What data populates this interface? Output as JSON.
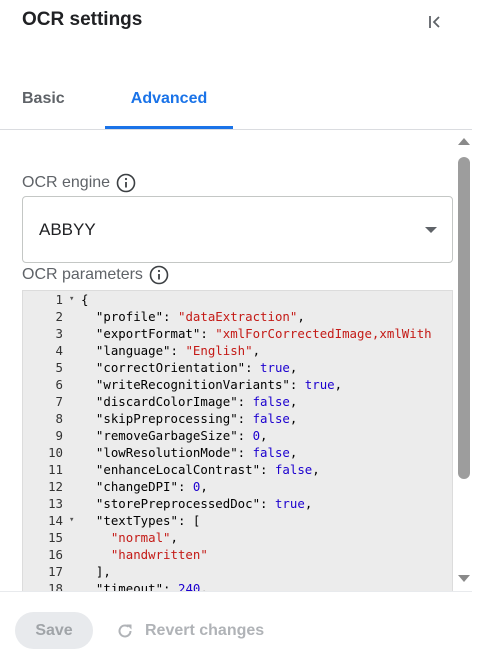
{
  "header": {
    "title": "OCR settings",
    "collapse_icon": "collapse-panel-icon"
  },
  "tabs": [
    {
      "label": "Basic",
      "active": false
    },
    {
      "label": "Advanced",
      "active": true
    }
  ],
  "ocr_engine": {
    "label": "OCR engine",
    "value": "ABBYY",
    "info_icon": "info-icon"
  },
  "ocr_parameters": {
    "label": "OCR parameters",
    "info_icon": "info-icon",
    "lines": [
      {
        "n": "1",
        "fold": true,
        "tokens": [
          [
            "pun",
            "{"
          ]
        ]
      },
      {
        "n": "2",
        "fold": false,
        "tokens": [
          [
            "key",
            "  \"profile\": "
          ],
          [
            "str",
            "\"dataExtraction\""
          ],
          [
            "pun",
            ","
          ]
        ]
      },
      {
        "n": "3",
        "fold": false,
        "tokens": [
          [
            "key",
            "  \"exportFormat\": "
          ],
          [
            "str",
            "\"xmlForCorrectedImage,xmlWith"
          ]
        ]
      },
      {
        "n": "4",
        "fold": false,
        "tokens": [
          [
            "key",
            "  \"language\": "
          ],
          [
            "str",
            "\"English\""
          ],
          [
            "pun",
            ","
          ]
        ]
      },
      {
        "n": "5",
        "fold": false,
        "tokens": [
          [
            "key",
            "  \"correctOrientation\": "
          ],
          [
            "kw",
            "true"
          ],
          [
            "pun",
            ","
          ]
        ]
      },
      {
        "n": "6",
        "fold": false,
        "tokens": [
          [
            "key",
            "  \"writeRecognitionVariants\": "
          ],
          [
            "kw",
            "true"
          ],
          [
            "pun",
            ","
          ]
        ]
      },
      {
        "n": "7",
        "fold": false,
        "tokens": [
          [
            "key",
            "  \"discardColorImage\": "
          ],
          [
            "kw",
            "false"
          ],
          [
            "pun",
            ","
          ]
        ]
      },
      {
        "n": "8",
        "fold": false,
        "tokens": [
          [
            "key",
            "  \"skipPreprocessing\": "
          ],
          [
            "kw",
            "false"
          ],
          [
            "pun",
            ","
          ]
        ]
      },
      {
        "n": "9",
        "fold": false,
        "tokens": [
          [
            "key",
            "  \"removeGarbageSize\": "
          ],
          [
            "num",
            "0"
          ],
          [
            "pun",
            ","
          ]
        ]
      },
      {
        "n": "10",
        "fold": false,
        "tokens": [
          [
            "key",
            "  \"lowResolutionMode\": "
          ],
          [
            "kw",
            "false"
          ],
          [
            "pun",
            ","
          ]
        ]
      },
      {
        "n": "11",
        "fold": false,
        "tokens": [
          [
            "key",
            "  \"enhanceLocalContrast\": "
          ],
          [
            "kw",
            "false"
          ],
          [
            "pun",
            ","
          ]
        ]
      },
      {
        "n": "12",
        "fold": false,
        "tokens": [
          [
            "key",
            "  \"changeDPI\": "
          ],
          [
            "num",
            "0"
          ],
          [
            "pun",
            ","
          ]
        ]
      },
      {
        "n": "13",
        "fold": false,
        "tokens": [
          [
            "key",
            "  \"storePreprocessedDoc\": "
          ],
          [
            "kw",
            "true"
          ],
          [
            "pun",
            ","
          ]
        ]
      },
      {
        "n": "14",
        "fold": true,
        "tokens": [
          [
            "key",
            "  \"textTypes\": "
          ],
          [
            "pun",
            "["
          ]
        ]
      },
      {
        "n": "15",
        "fold": false,
        "tokens": [
          [
            "str",
            "    \"normal\""
          ],
          [
            "pun",
            ","
          ]
        ]
      },
      {
        "n": "16",
        "fold": false,
        "tokens": [
          [
            "str",
            "    \"handwritten\""
          ]
        ]
      },
      {
        "n": "17",
        "fold": false,
        "tokens": [
          [
            "pun",
            "  ],"
          ]
        ]
      },
      {
        "n": "18",
        "fold": false,
        "tokens": [
          [
            "key",
            "  \"timeout\": "
          ],
          [
            "num",
            "240"
          ],
          [
            "pun",
            ","
          ]
        ]
      }
    ]
  },
  "footer": {
    "save_label": "Save",
    "revert_label": "Revert changes",
    "revert_icon": "revert-icon"
  },
  "colors": {
    "accent": "#1a73e8",
    "string": "#c41a16",
    "keyword": "#1c00cf"
  }
}
